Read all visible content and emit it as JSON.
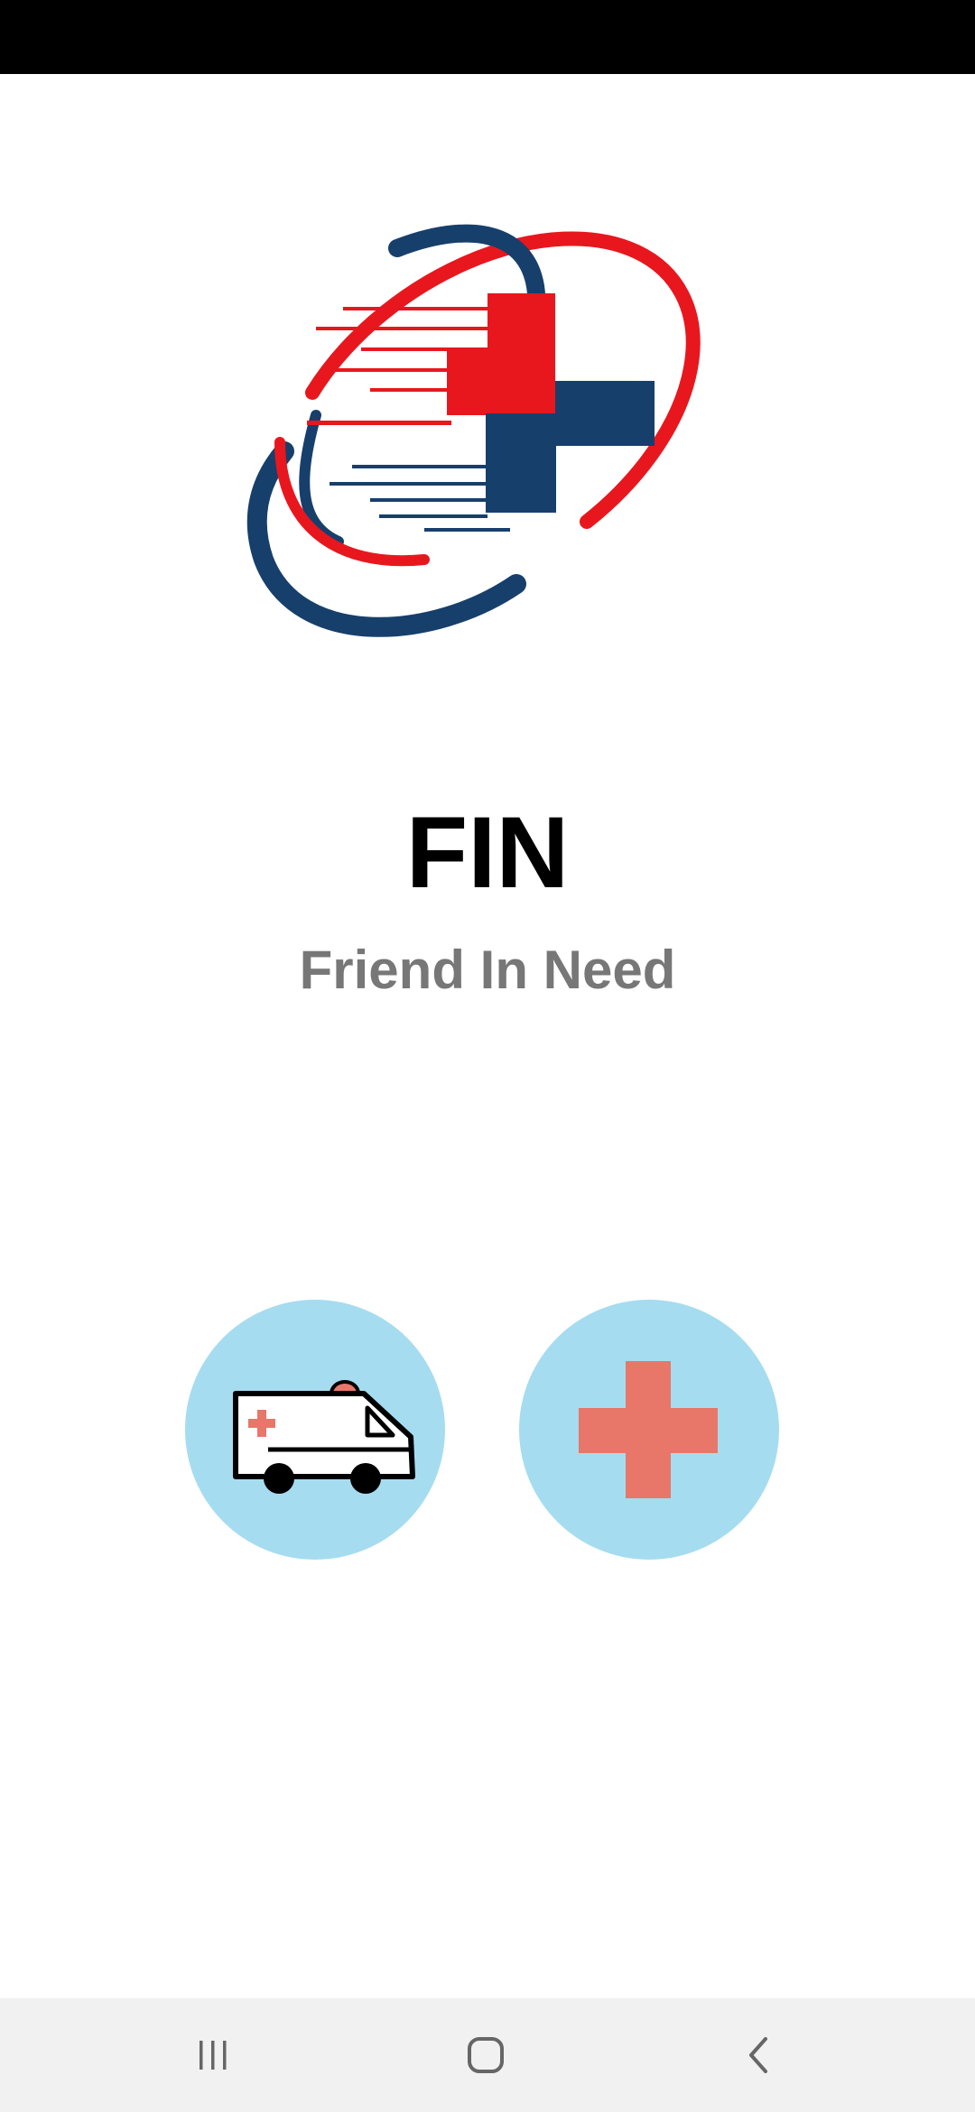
{
  "app": {
    "title": "FIN",
    "subtitle": "Friend In Need"
  },
  "colors": {
    "logo_red": "#e8171e",
    "logo_blue": "#173f6b",
    "circle_bg": "#a6dcf0",
    "cross": "#e8776a",
    "subtitle_gray": "#777777"
  },
  "actions": [
    {
      "icon": "ambulance-icon"
    },
    {
      "icon": "first-aid-cross-icon"
    }
  ],
  "navigation": {
    "icons": [
      "recents-icon",
      "home-icon",
      "back-icon"
    ]
  }
}
